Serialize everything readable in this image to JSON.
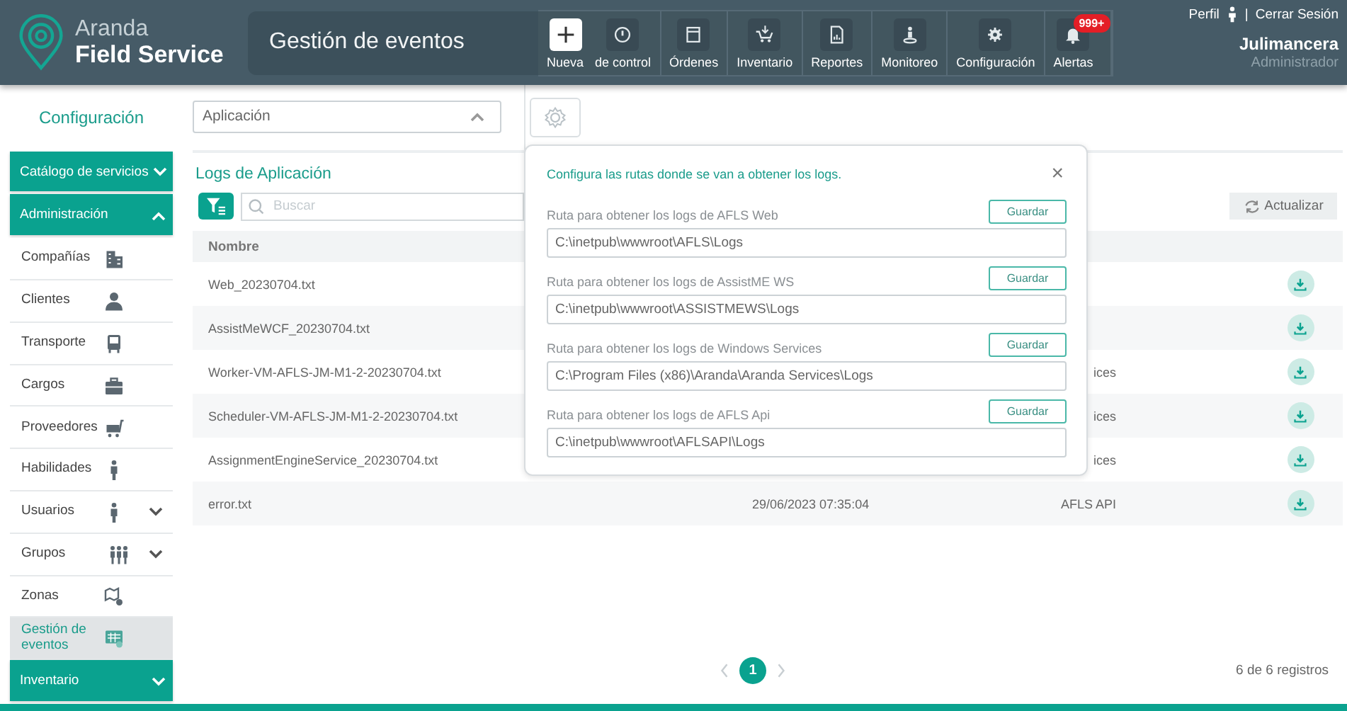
{
  "app": {
    "brand": "Aranda",
    "product": "Field Service"
  },
  "page_title": "Gestión de eventos",
  "nav": [
    {
      "label": "Nueva",
      "kind": "primary"
    },
    {
      "label": "de control",
      "kind": "normal"
    },
    {
      "label": "Órdenes",
      "kind": "normal"
    },
    {
      "label": "Inventario",
      "kind": "normal"
    },
    {
      "label": "Reportes",
      "kind": "normal"
    },
    {
      "label": "Monitoreo",
      "kind": "normal"
    },
    {
      "label": "Configuración",
      "kind": "normal"
    },
    {
      "label": "Alertas",
      "kind": "normal",
      "badge": "999+"
    }
  ],
  "user": {
    "profile_link": "Perfil",
    "separator": "|",
    "logout_link": "Cerrar Sesión",
    "name": "Julimancera",
    "role": "Administrador"
  },
  "sidebar": {
    "heading": "Configuración",
    "sections": [
      {
        "label": "Catálogo de servicios",
        "expanded": false
      },
      {
        "label": "Administración",
        "expanded": true,
        "children": [
          {
            "label": "Compañías",
            "expandable": false,
            "selected": false
          },
          {
            "label": "Clientes",
            "expandable": false,
            "selected": false
          },
          {
            "label": "Transporte",
            "expandable": false,
            "selected": false
          },
          {
            "label": "Cargos",
            "expandable": false,
            "selected": false
          },
          {
            "label": "Proveedores",
            "expandable": false,
            "selected": false
          },
          {
            "label": "Habilidades",
            "expandable": false,
            "selected": false
          },
          {
            "label": "Usuarios",
            "expandable": true,
            "selected": false
          },
          {
            "label": "Grupos",
            "expandable": true,
            "selected": false
          },
          {
            "label": "Zonas",
            "expandable": false,
            "selected": false
          },
          {
            "label": "Gestión de eventos",
            "expandable": false,
            "selected": true
          }
        ]
      },
      {
        "label": "Inventario",
        "expanded": false
      }
    ]
  },
  "source_select": {
    "value": "Aplicación",
    "expanded": true
  },
  "panel": {
    "title": "Logs de Aplicación",
    "search": {
      "placeholder": "Buscar"
    },
    "refresh_button": "Actualizar",
    "table": {
      "columns": [
        "Nombre"
      ],
      "rows": [
        {
          "name": "Web_20230704.txt"
        },
        {
          "name": "AssistMeWCF_20230704.txt"
        },
        {
          "name": "Worker-VM-AFLS-JM-M1-2-20230704.txt",
          "column_3": "ices"
        },
        {
          "name": "Scheduler-VM-AFLS-JM-M1-2-20230704.txt",
          "column_3": "ices"
        },
        {
          "name": "AssignmentEngineService_20230704.txt",
          "column_3": "ices"
        },
        {
          "name": "error.txt",
          "column_2": "29/06/2023 07:35:04",
          "column_3": "AFLS API"
        }
      ]
    },
    "pagination": {
      "pages": [
        {
          "label": "1",
          "selected": true
        }
      ],
      "summary": "6 de 6 registros"
    }
  },
  "popover": {
    "intro": "Configura las rutas donde se van a obtener los logs.",
    "close": "×",
    "routes": [
      {
        "label": "Ruta para obtener los logs de AFLS Web",
        "value": "C:\\inetpub\\wwwroot\\AFLS\\Logs",
        "button": "Guardar"
      },
      {
        "label": "Ruta para obtener los logs de AssistME WS",
        "value": "C:\\inetpub\\wwwroot\\ASSISTMEWS\\Logs",
        "button": "Guardar"
      },
      {
        "label": "Ruta para obtener los logs de Windows Services",
        "value": "C:\\Program Files (x86)\\Aranda\\Aranda Services\\Logs",
        "button": "Guardar"
      },
      {
        "label": "Ruta para obtener los logs de AFLS Api",
        "value": "C:\\inetpub\\wwwroot\\AFLSAPI\\Logs",
        "button": "Guardar"
      }
    ]
  }
}
